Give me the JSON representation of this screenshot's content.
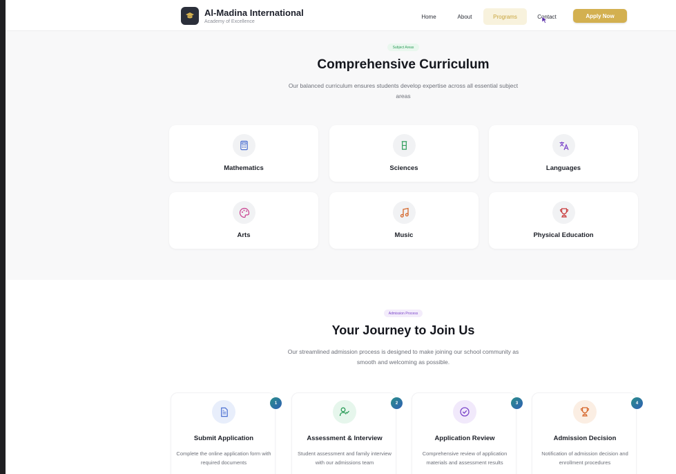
{
  "header": {
    "brand_title": "Al-Madina International",
    "brand_subtitle": "Academy of Excellence",
    "nav": [
      "Home",
      "About",
      "Programs",
      "Contact"
    ],
    "active_nav": "Programs",
    "apply_label": "Apply Now"
  },
  "curriculum": {
    "badge": "Subject Areas",
    "title": "Comprehensive Curriculum",
    "description": "Our balanced curriculum ensures students develop expertise across all essential subject areas",
    "subjects": [
      {
        "label": "Mathematics",
        "icon": "calculator-icon",
        "color": "#4b6fd1"
      },
      {
        "label": "Sciences",
        "icon": "beaker-icon",
        "color": "#2e9d5a"
      },
      {
        "label": "Languages",
        "icon": "translate-icon",
        "color": "#7b45c9"
      },
      {
        "label": "Arts",
        "icon": "palette-icon",
        "color": "#c93f8f"
      },
      {
        "label": "Music",
        "icon": "music-note-icon",
        "color": "#d5662a"
      },
      {
        "label": "Physical Education",
        "icon": "trophy-icon",
        "color": "#c83a3a"
      }
    ]
  },
  "admission": {
    "badge": "Admission Process",
    "title": "Your Journey to Join Us",
    "description": "Our streamlined admission process is designed to make joining our school community as smooth and welcoming as possible.",
    "steps": [
      {
        "number": "1",
        "title": "Submit Application",
        "desc": "Complete the online application form with required documents",
        "icon": "document-icon",
        "color": "#4b6fd1",
        "bg": "#e8eefb"
      },
      {
        "number": "2",
        "title": "Assessment & Interview",
        "desc": "Student assessment and family interview with our admissions team",
        "icon": "user-check-icon",
        "color": "#2e9d5a",
        "bg": "#e6f6ec"
      },
      {
        "number": "3",
        "title": "Application Review",
        "desc": "Comprehensive review of application materials and assessment results",
        "icon": "check-circle-icon",
        "color": "#7b45c9",
        "bg": "#f1e9fb"
      },
      {
        "number": "4",
        "title": "Admission Decision",
        "desc": "Notification of admission decision and enrollment procedures",
        "icon": "trophy-icon",
        "color": "#d5662a",
        "bg": "#fbeee3"
      }
    ]
  }
}
